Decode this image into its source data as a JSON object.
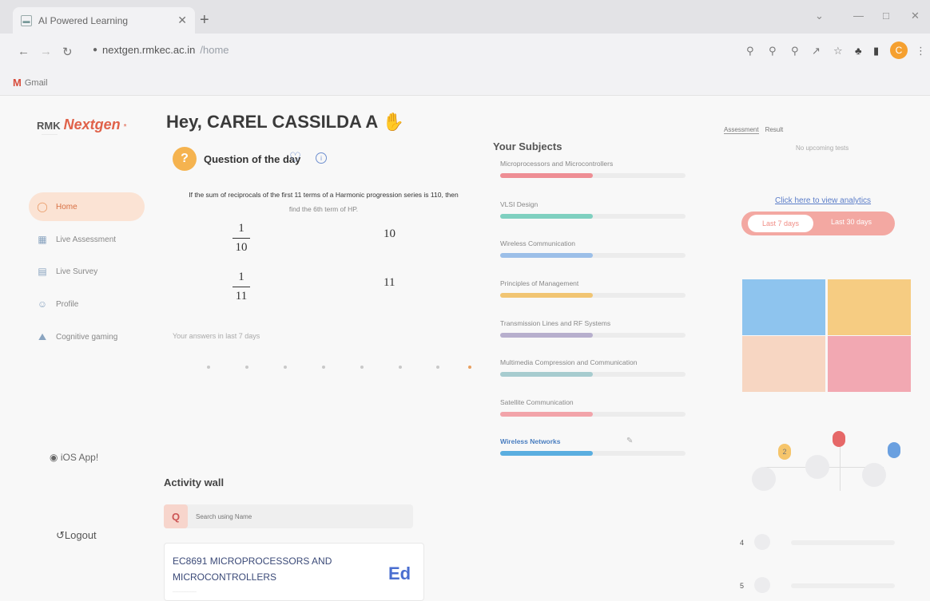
{
  "browser": {
    "tab_title": "AI Powered Learning",
    "url_host": "nextgen.rmkec.ac.in",
    "url_path": "/home",
    "profile_initial": "C",
    "bookmark_gmail": "Gmail"
  },
  "sidebar": {
    "brand_prefix": "RMK",
    "brand_name": "Nextgen",
    "items": [
      {
        "label": "Home",
        "icon": "home-icon"
      },
      {
        "label": "Live Assessment",
        "icon": "assessment-icon"
      },
      {
        "label": "Live Survey",
        "icon": "survey-icon"
      },
      {
        "label": "Profile",
        "icon": "profile-icon"
      },
      {
        "label": "Cognitive gaming",
        "icon": "gaming-icon"
      }
    ],
    "ios_label": "iOS App!",
    "logout_label": "Logout"
  },
  "main": {
    "greeting": "Hey, CAREL CASSILDA A",
    "qod_title": "Question of the day",
    "question_line1": "If the sum of reciprocals of the first 11 terms of a Harmonic progression series is 110, then",
    "question_line2": "find the 6th term of HP.",
    "options": [
      {
        "type": "fraction",
        "num": "1",
        "den": "10"
      },
      {
        "type": "text",
        "value": "10"
      },
      {
        "type": "fraction",
        "num": "1",
        "den": "11"
      },
      {
        "type": "text",
        "value": "11"
      }
    ],
    "answers_label": "Your answers in last 7 days",
    "activity_title": "Activity wall",
    "search_placeholder": "Search using Name",
    "card_title": "EC8691 MICROPROCESSORS AND MICROCONTROLLERS",
    "card_badge": "Ed"
  },
  "subjects": {
    "title": "Your Subjects",
    "items": [
      {
        "name": "Microprocessors and Microcontrollers",
        "progress": 0.5,
        "color": "#ee8e94"
      },
      {
        "name": "VLSI Design",
        "progress": 0.5,
        "color": "#7fd0c0"
      },
      {
        "name": "Wireless Communication",
        "progress": 0.5,
        "color": "#9cbfe8"
      },
      {
        "name": "Principles of Management",
        "progress": 0.5,
        "color": "#f1c573"
      },
      {
        "name": "Transmission Lines and RF Systems",
        "progress": 0.5,
        "color": "#b7afcd"
      },
      {
        "name": "Multimedia Compression and Communication",
        "progress": 0.5,
        "color": "#a7cccf"
      },
      {
        "name": "Satellite Communication",
        "progress": 0.5,
        "color": "#f2a4aa"
      },
      {
        "name": "Wireless Networks",
        "progress": 0.5,
        "color": "#5aaee0",
        "highlight": true
      }
    ]
  },
  "right_panel": {
    "tab_assessment": "Assessment",
    "tab_result": "Result",
    "no_tests": "No upcoming tests",
    "analytics_link": "Click here to view analytics",
    "toggle_on": "Last 7 days",
    "toggle_off": "Last 30 days",
    "quad_colors": [
      "#8ec4ee",
      "#f6cc82",
      "#f7d6c2",
      "#f2a8b2"
    ],
    "tree_badge_color": "#f6c56b",
    "tree_badge_value": "2",
    "leaderboard": [
      {
        "rank": "4"
      },
      {
        "rank": "5"
      }
    ]
  }
}
